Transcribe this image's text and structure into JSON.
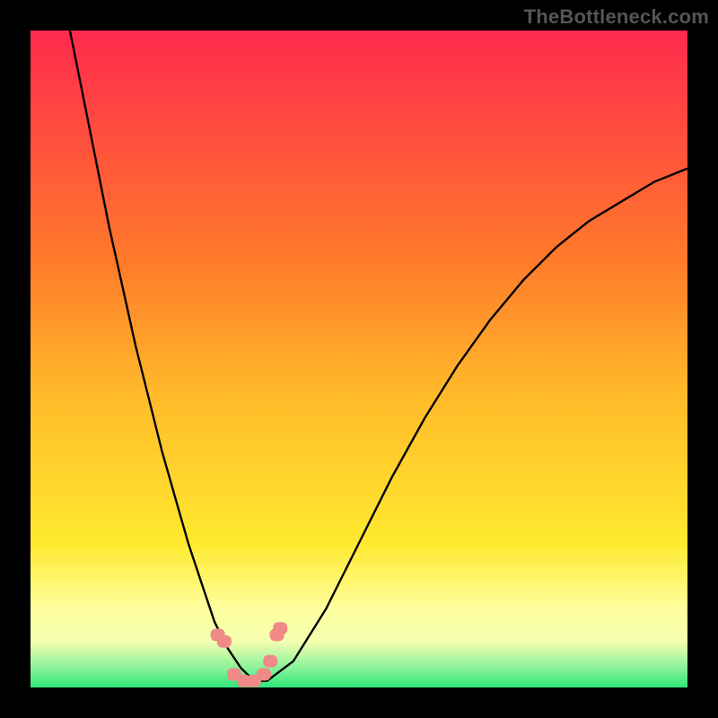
{
  "watermark": "TheBottleneck.com",
  "colors": {
    "black": "#000000",
    "red": "#ff2a4e",
    "orange": "#ff8a2a",
    "yellow": "#ffe92e",
    "paleYellow": "#ffffaa",
    "green": "#2fe77a",
    "curve": "#000000",
    "marker": "#ef8a86"
  },
  "chart_data": {
    "type": "line",
    "title": "",
    "xlabel": "",
    "ylabel": "",
    "xlim": [
      0,
      100
    ],
    "ylim": [
      0,
      100
    ],
    "grid": false,
    "legend": false,
    "series": [
      {
        "name": "bottleneck-curve",
        "x": [
          6,
          8,
          10,
          12,
          14,
          16,
          18,
          20,
          22,
          24,
          26,
          28,
          30,
          32,
          34,
          36,
          40,
          45,
          50,
          55,
          60,
          65,
          70,
          75,
          80,
          85,
          90,
          95,
          100
        ],
        "y": [
          100,
          90,
          80,
          70,
          61,
          52,
          44,
          36,
          29,
          22,
          16,
          10,
          6,
          3,
          1,
          1,
          4,
          12,
          22,
          32,
          41,
          49,
          56,
          62,
          67,
          71,
          74,
          77,
          79
        ]
      }
    ],
    "optimal_zone": {
      "x_start": 29,
      "x_end": 37,
      "y": 1
    },
    "markers": [
      {
        "x": 28.5,
        "y": 8
      },
      {
        "x": 29.5,
        "y": 7
      },
      {
        "x": 31,
        "y": 2
      },
      {
        "x": 32.5,
        "y": 1
      },
      {
        "x": 34,
        "y": 1
      },
      {
        "x": 35.5,
        "y": 2
      },
      {
        "x": 36.5,
        "y": 4
      },
      {
        "x": 37.5,
        "y": 8
      },
      {
        "x": 38,
        "y": 9
      }
    ]
  }
}
